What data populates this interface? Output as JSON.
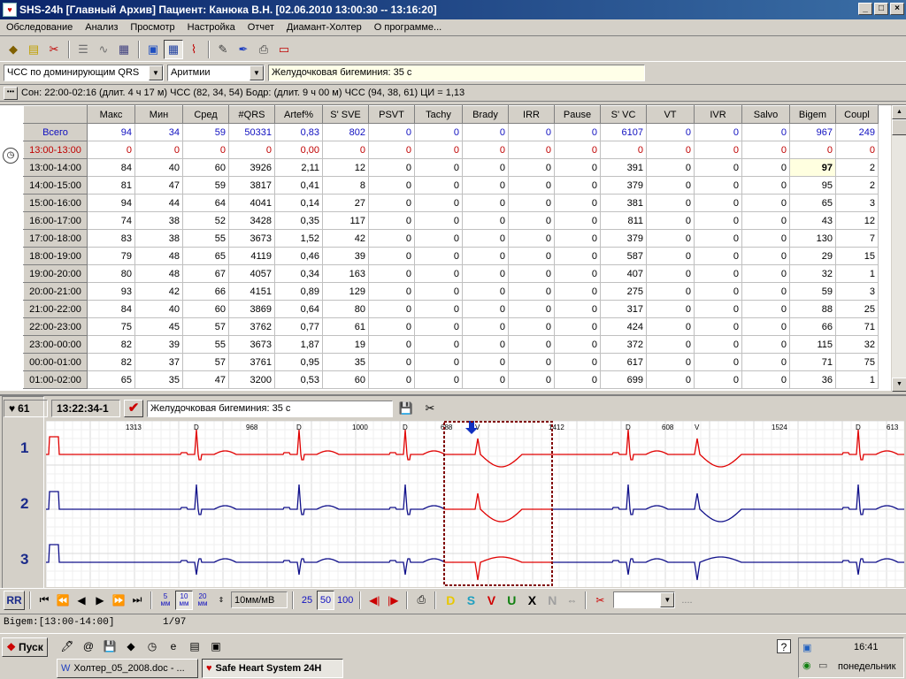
{
  "window": {
    "title": "SHS-24h [Главный Архив] Пациент: Канюка В.Н. [02.06.2010 13:00:30 -- 13:16:20]",
    "minimize": "_",
    "maximize": "□",
    "close": "×"
  },
  "menu": [
    "Обследование",
    "Анализ",
    "Просмотр",
    "Настройка",
    "Отчет",
    "Диамант-Холтер",
    "О программе..."
  ],
  "filters": {
    "rhythm_combo": "ЧСС по доминирующим QRS",
    "type_combo": "Аритмии",
    "description": "Желудочковая бигеминия: 35 с"
  },
  "info_line": "Сон: 22:00-02:16 (длит. 4 ч 17 м) ЧСС (82, 34, 54)  Бодр: (длит. 9 ч 00 м) ЧСС (94, 38, 61)  ЦИ = 1,13",
  "table": {
    "columns": [
      "Макс",
      "Мин",
      "Сред",
      "#QRS",
      "Artef%",
      "S' SVE",
      "PSVT",
      "Tachy",
      "Brady",
      "IRR",
      "Pause",
      "S' VC",
      "VT",
      "IVR",
      "Salvo",
      "Bigem",
      "Coupl"
    ],
    "rows": [
      {
        "label": "Всего",
        "kind": "total",
        "cells": [
          "94",
          "34",
          "59",
          "50331",
          "0,83",
          "802",
          "0",
          "0",
          "0",
          "0",
          "0",
          "6107",
          "0",
          "0",
          "0",
          "967",
          "249"
        ]
      },
      {
        "label": "13:00-13:00",
        "kind": "red",
        "cells": [
          "0",
          "0",
          "0",
          "0",
          "0,00",
          "0",
          "0",
          "0",
          "0",
          "0",
          "0",
          "0",
          "0",
          "0",
          "0",
          "0",
          "0"
        ]
      },
      {
        "label": "13:00-14:00",
        "kind": "normal",
        "cells": [
          "84",
          "40",
          "60",
          "3926",
          "2,11",
          "12",
          "0",
          "0",
          "0",
          "0",
          "0",
          "391",
          "0",
          "0",
          "0",
          "97",
          "2"
        ]
      },
      {
        "label": "14:00-15:00",
        "kind": "normal",
        "cells": [
          "81",
          "47",
          "59",
          "3817",
          "0,41",
          "8",
          "0",
          "0",
          "0",
          "0",
          "0",
          "379",
          "0",
          "0",
          "0",
          "95",
          "2"
        ]
      },
      {
        "label": "15:00-16:00",
        "kind": "normal",
        "cells": [
          "94",
          "44",
          "64",
          "4041",
          "0,14",
          "27",
          "0",
          "0",
          "0",
          "0",
          "0",
          "381",
          "0",
          "0",
          "0",
          "65",
          "3"
        ]
      },
      {
        "label": "16:00-17:00",
        "kind": "normal",
        "cells": [
          "74",
          "38",
          "52",
          "3428",
          "0,35",
          "117",
          "0",
          "0",
          "0",
          "0",
          "0",
          "811",
          "0",
          "0",
          "0",
          "43",
          "12"
        ]
      },
      {
        "label": "17:00-18:00",
        "kind": "normal",
        "cells": [
          "83",
          "38",
          "55",
          "3673",
          "1,52",
          "42",
          "0",
          "0",
          "0",
          "0",
          "0",
          "379",
          "0",
          "0",
          "0",
          "130",
          "7"
        ]
      },
      {
        "label": "18:00-19:00",
        "kind": "normal",
        "cells": [
          "79",
          "48",
          "65",
          "4119",
          "0,46",
          "39",
          "0",
          "0",
          "0",
          "0",
          "0",
          "587",
          "0",
          "0",
          "0",
          "29",
          "15"
        ]
      },
      {
        "label": "19:00-20:00",
        "kind": "normal",
        "cells": [
          "80",
          "48",
          "67",
          "4057",
          "0,34",
          "163",
          "0",
          "0",
          "0",
          "0",
          "0",
          "407",
          "0",
          "0",
          "0",
          "32",
          "1"
        ]
      },
      {
        "label": "20:00-21:00",
        "kind": "normal",
        "cells": [
          "93",
          "42",
          "66",
          "4151",
          "0,89",
          "129",
          "0",
          "0",
          "0",
          "0",
          "0",
          "275",
          "0",
          "0",
          "0",
          "59",
          "3"
        ]
      },
      {
        "label": "21:00-22:00",
        "kind": "normal",
        "cells": [
          "84",
          "40",
          "60",
          "3869",
          "0,64",
          "80",
          "0",
          "0",
          "0",
          "0",
          "0",
          "317",
          "0",
          "0",
          "0",
          "88",
          "25"
        ]
      },
      {
        "label": "22:00-23:00",
        "kind": "normal",
        "cells": [
          "75",
          "45",
          "57",
          "3762",
          "0,77",
          "61",
          "0",
          "0",
          "0",
          "0",
          "0",
          "424",
          "0",
          "0",
          "0",
          "66",
          "71"
        ]
      },
      {
        "label": "23:00-00:00",
        "kind": "normal",
        "cells": [
          "82",
          "39",
          "55",
          "3673",
          "1,87",
          "19",
          "0",
          "0",
          "0",
          "0",
          "0",
          "372",
          "0",
          "0",
          "0",
          "115",
          "32"
        ]
      },
      {
        "label": "00:00-01:00",
        "kind": "normal",
        "cells": [
          "82",
          "37",
          "57",
          "3761",
          "0,95",
          "35",
          "0",
          "0",
          "0",
          "0",
          "0",
          "617",
          "0",
          "0",
          "0",
          "71",
          "75"
        ]
      },
      {
        "label": "01:00-02:00",
        "kind": "normal",
        "cells": [
          "65",
          "35",
          "47",
          "3200",
          "0,53",
          "60",
          "0",
          "0",
          "0",
          "0",
          "0",
          "699",
          "0",
          "0",
          "0",
          "36",
          "1"
        ]
      }
    ],
    "selected_cell": "97"
  },
  "ecg": {
    "hr": "61",
    "time": "13:22:34-1",
    "event_text": "Желудочковая бигеминия: 35 с",
    "leads": [
      "1",
      "2",
      "3"
    ],
    "rr_labels": [
      "1313",
      "968",
      "1000",
      "688",
      "1412",
      "608",
      "1524",
      "613"
    ],
    "beat_labels": [
      "D",
      "D",
      "D",
      "V",
      "D",
      "V",
      "D"
    ]
  },
  "bottom_toolbar": {
    "rr": "RR",
    "scales": [
      [
        "5",
        "мм"
      ],
      [
        "10",
        "мм"
      ],
      [
        "20",
        "мм"
      ]
    ],
    "gain": "10мм/мВ",
    "speeds": [
      "25",
      "50",
      "100"
    ],
    "letters": [
      "D",
      "S",
      "V",
      "U",
      "X",
      "N"
    ],
    "letter_colors": {
      "D": "#e8c800",
      "S": "#20a0c0",
      "V": "#d00000",
      "U": "#108010",
      "X": "#000000",
      "N": "#a0a0a0"
    },
    "dots": "...."
  },
  "status": {
    "left": "Bigem:[13:00-14:00]",
    "right": "1/97"
  },
  "taskbar": {
    "start": "Пуск",
    "tasks": [
      "Холтер_05_2008.doc - ...",
      "Safe Heart System 24H"
    ],
    "clock": "16:41",
    "day": "понедельник"
  }
}
